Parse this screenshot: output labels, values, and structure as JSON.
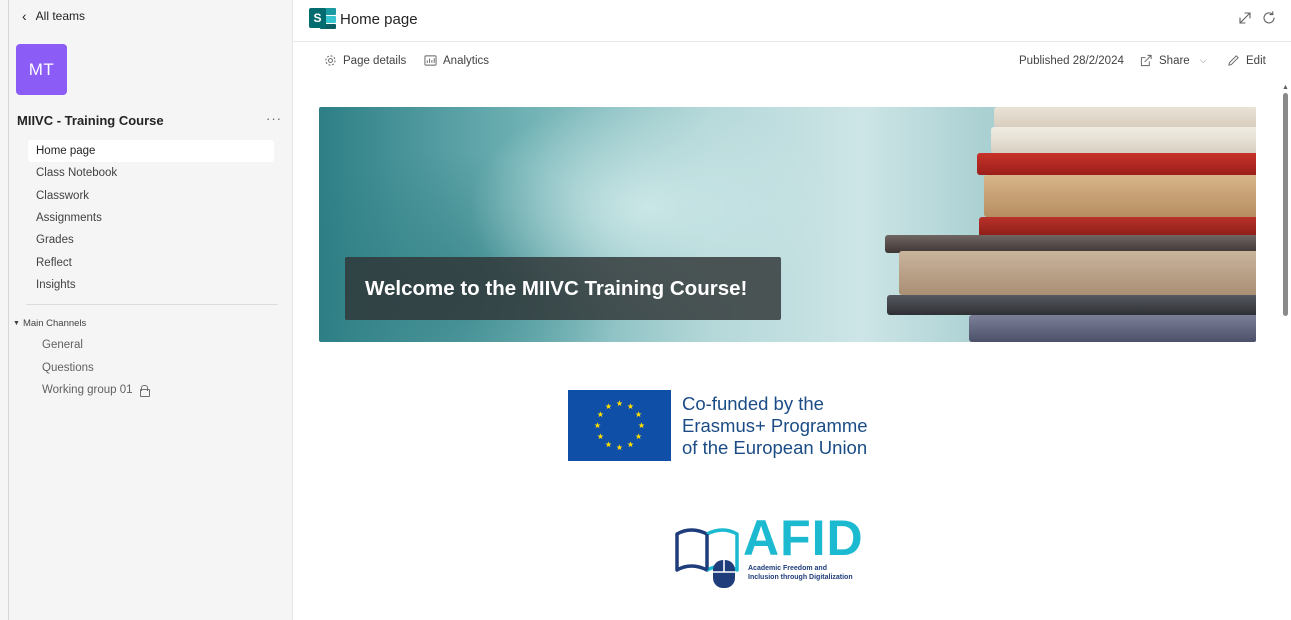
{
  "sidebar": {
    "back_label": "All teams",
    "avatar_initials": "MT",
    "avatar_color": "#8b5cf6",
    "team_name": "MIIVC - Training Course",
    "more_label": "···",
    "nav_items": [
      {
        "label": "Home page",
        "active": true
      },
      {
        "label": "Class Notebook"
      },
      {
        "label": "Classwork"
      },
      {
        "label": "Assignments"
      },
      {
        "label": "Grades"
      },
      {
        "label": "Reflect"
      },
      {
        "label": "Insights"
      }
    ],
    "channels_header": "Main Channels",
    "channels": [
      {
        "label": "General"
      },
      {
        "label": "Questions"
      },
      {
        "label": "Working group 01",
        "private": true
      }
    ]
  },
  "header": {
    "app_icon_letter": "S",
    "title": "Home page"
  },
  "commands": {
    "page_details": "Page details",
    "analytics": "Analytics",
    "published": "Published 28/2/2024",
    "share": "Share",
    "edit": "Edit"
  },
  "hero": {
    "caption": "Welcome to the MIIVC Training Course!"
  },
  "eu_logo": {
    "lines": [
      "Co-funded by the",
      "Erasmus+ Programme",
      "of the European Union"
    ],
    "flag_color": "#0f4fa8",
    "star_color": "#ffdd00"
  },
  "afid_logo": {
    "word": "AFID",
    "subtitle_lines": [
      "Academic Freedom and",
      "Inclusion through Digitalization"
    ],
    "accent": "#1cbad0",
    "dark": "#1f3d7a"
  },
  "colors": {
    "accent": "#8b5cf6",
    "sharepoint": "#036c70"
  }
}
